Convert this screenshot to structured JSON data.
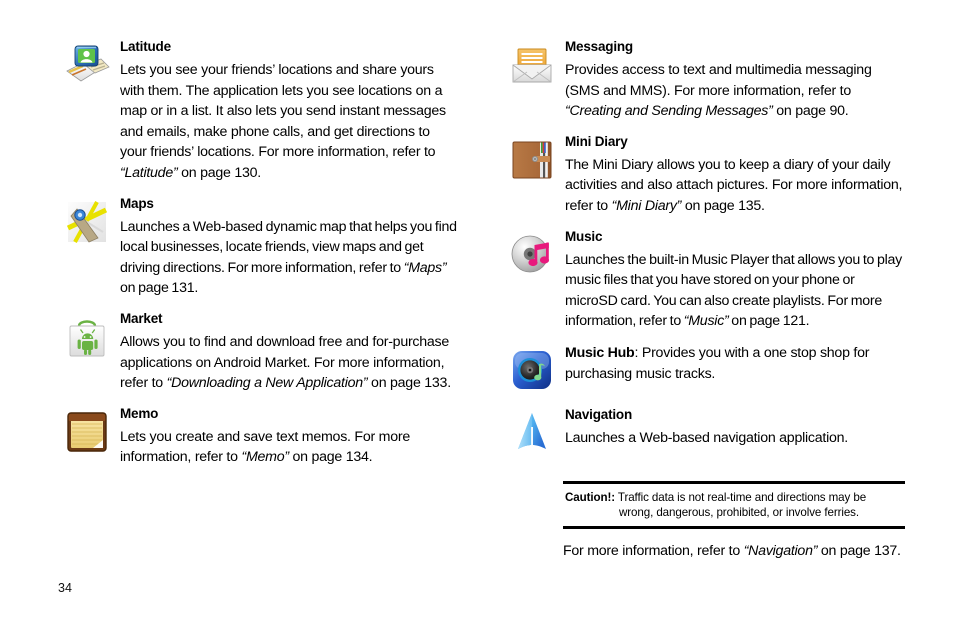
{
  "page": {
    "folio": "34",
    "columns": [
      {
        "id": "left",
        "entries": [
          {
            "icon": "latitude-icon",
            "title": "Latitude",
            "body_html": "Lets you see your friends’ locations and share yours with them. The application lets you see locations on a map or in a list. It also lets you send instant messages and emails, make phone calls, and get directions to your friends’ locations. For more information, refer to <span class=\"em\">“Latitude”</span> on page 130."
          },
          {
            "icon": "maps-icon",
            "title": "Maps",
            "body_html": "Launches a Web-based dynamic map that helps you find local businesses, locate friends, view maps and get driving directions. For more information, refer to <span class=\"em\">“Maps”</span> on page 131."
          },
          {
            "icon": "market-icon",
            "title": "Market",
            "body_html": "Allows you to find and download free and for-purchase applications on Android Market. For more information, refer to <span class=\"em\">“Downloading a New Application”</span> on page 133."
          },
          {
            "icon": "memo-icon",
            "title": "Memo",
            "body_html": "Lets you create and save text memos. For more information, refer to <span class=\"em\">“Memo”</span> on page 134."
          }
        ]
      },
      {
        "id": "right",
        "entries": [
          {
            "icon": "messaging-icon",
            "title": "Messaging",
            "body_html": "Provides access to text and multimedia messaging (SMS and MMS). For more information, refer to <span class=\"em\">“Creating and Sending Messages”</span> on page 90."
          },
          {
            "icon": "mini-diary-icon",
            "title": "Mini Diary",
            "body_html": "The Mini Diary allows you to keep a diary of your daily activities and also attach pictures. For more information, refer to <span class=\"em\">“Mini Diary”</span> on page 135."
          },
          {
            "icon": "music-icon",
            "title": "Music",
            "body_html": "Launches the built-in Music Player that allows you to play music files that you have stored on your phone or microSD card. You can also create playlists. For more information, refer to <span class=\"em\">“Music”</span> on page 121."
          },
          {
            "icon": "music-hub-icon",
            "title": "",
            "inline_title": "Music Hub",
            "body_html": "<span class=\"strong\">Music Hub</span>: Provides you with a one stop shop for purchasing music tracks."
          },
          {
            "icon": "navigation-icon",
            "title": "Navigation",
            "body_html": "Launches a Web-based navigation application."
          }
        ]
      }
    ]
  },
  "caution_note": {
    "label": "Caution!:",
    "line1": " Traffic data is not real-time and directions may be",
    "line2": "wrong, dangerous, prohibited, or involve ferries."
  },
  "note_after": {
    "text_before": "For more information, refer to ",
    "ref": "“Navigation”",
    "text_after": " on page 137."
  },
  "colors": {
    "page_background": "#ffffff",
    "text": "#000000",
    "rule": "#000000",
    "latitude_blue": "#2d6fb8",
    "maps_yellow": "#e8e100",
    "maps_road": "#b8a885",
    "market_green": "#6ab344",
    "memo_brown": "#6b3a15",
    "memo_paper": "#f3d98a",
    "messaging_orange": "#f0ad3c",
    "diary_brown": "#a9693a",
    "music_pink": "#e8197d",
    "music_hub_blue": "#2a5fd0",
    "navigation_blue": "#49a8ee"
  }
}
